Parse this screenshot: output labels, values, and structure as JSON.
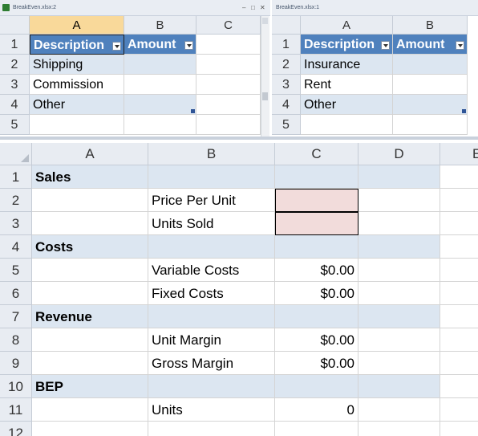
{
  "left_window": {
    "title": "BreakEven.xlsx:2",
    "controls": [
      "–",
      "□",
      "✕"
    ],
    "columns": [
      "A",
      "B",
      "C"
    ],
    "rows": [
      {
        "num": "1",
        "a": "Description",
        "b": "Amount",
        "c": ""
      },
      {
        "num": "2",
        "a": "Shipping",
        "b": "",
        "c": ""
      },
      {
        "num": "3",
        "a": "Commission",
        "b": "",
        "c": ""
      },
      {
        "num": "4",
        "a": "Other",
        "b": "",
        "c": ""
      },
      {
        "num": "5",
        "a": "",
        "b": "",
        "c": ""
      }
    ]
  },
  "right_window": {
    "title": "BreakEven.xlsx:1",
    "columns": [
      "A",
      "B"
    ],
    "rows": [
      {
        "num": "1",
        "a": "Description",
        "b": "Amount"
      },
      {
        "num": "2",
        "a": "Insurance",
        "b": ""
      },
      {
        "num": "3",
        "a": "Rent",
        "b": ""
      },
      {
        "num": "4",
        "a": "Other",
        "b": ""
      },
      {
        "num": "5",
        "a": "",
        "b": ""
      }
    ]
  },
  "main_sheet": {
    "columns": [
      "A",
      "B",
      "C",
      "D",
      "E"
    ],
    "rows": [
      {
        "num": "1",
        "a": "Sales",
        "b": "",
        "c": ""
      },
      {
        "num": "2",
        "a": "",
        "b": "Price Per Unit",
        "c": ""
      },
      {
        "num": "3",
        "a": "",
        "b": "Units Sold",
        "c": ""
      },
      {
        "num": "4",
        "a": "Costs",
        "b": "",
        "c": ""
      },
      {
        "num": "5",
        "a": "",
        "b": "Variable Costs",
        "c": "$0.00"
      },
      {
        "num": "6",
        "a": "",
        "b": "Fixed Costs",
        "c": "$0.00"
      },
      {
        "num": "7",
        "a": "Revenue",
        "b": "",
        "c": ""
      },
      {
        "num": "8",
        "a": "",
        "b": "Unit Margin",
        "c": "$0.00"
      },
      {
        "num": "9",
        "a": "",
        "b": "Gross Margin",
        "c": "$0.00"
      },
      {
        "num": "10",
        "a": "BEP",
        "b": "",
        "c": ""
      },
      {
        "num": "11",
        "a": "",
        "b": "Units",
        "c": "0"
      },
      {
        "num": "12",
        "a": "",
        "b": "",
        "c": ""
      }
    ]
  },
  "colors": {
    "table_header": "#4f81bd",
    "band": "#dce6f1",
    "input_cell": "#f2dcdb",
    "selected_header": "#f9d99a"
  }
}
